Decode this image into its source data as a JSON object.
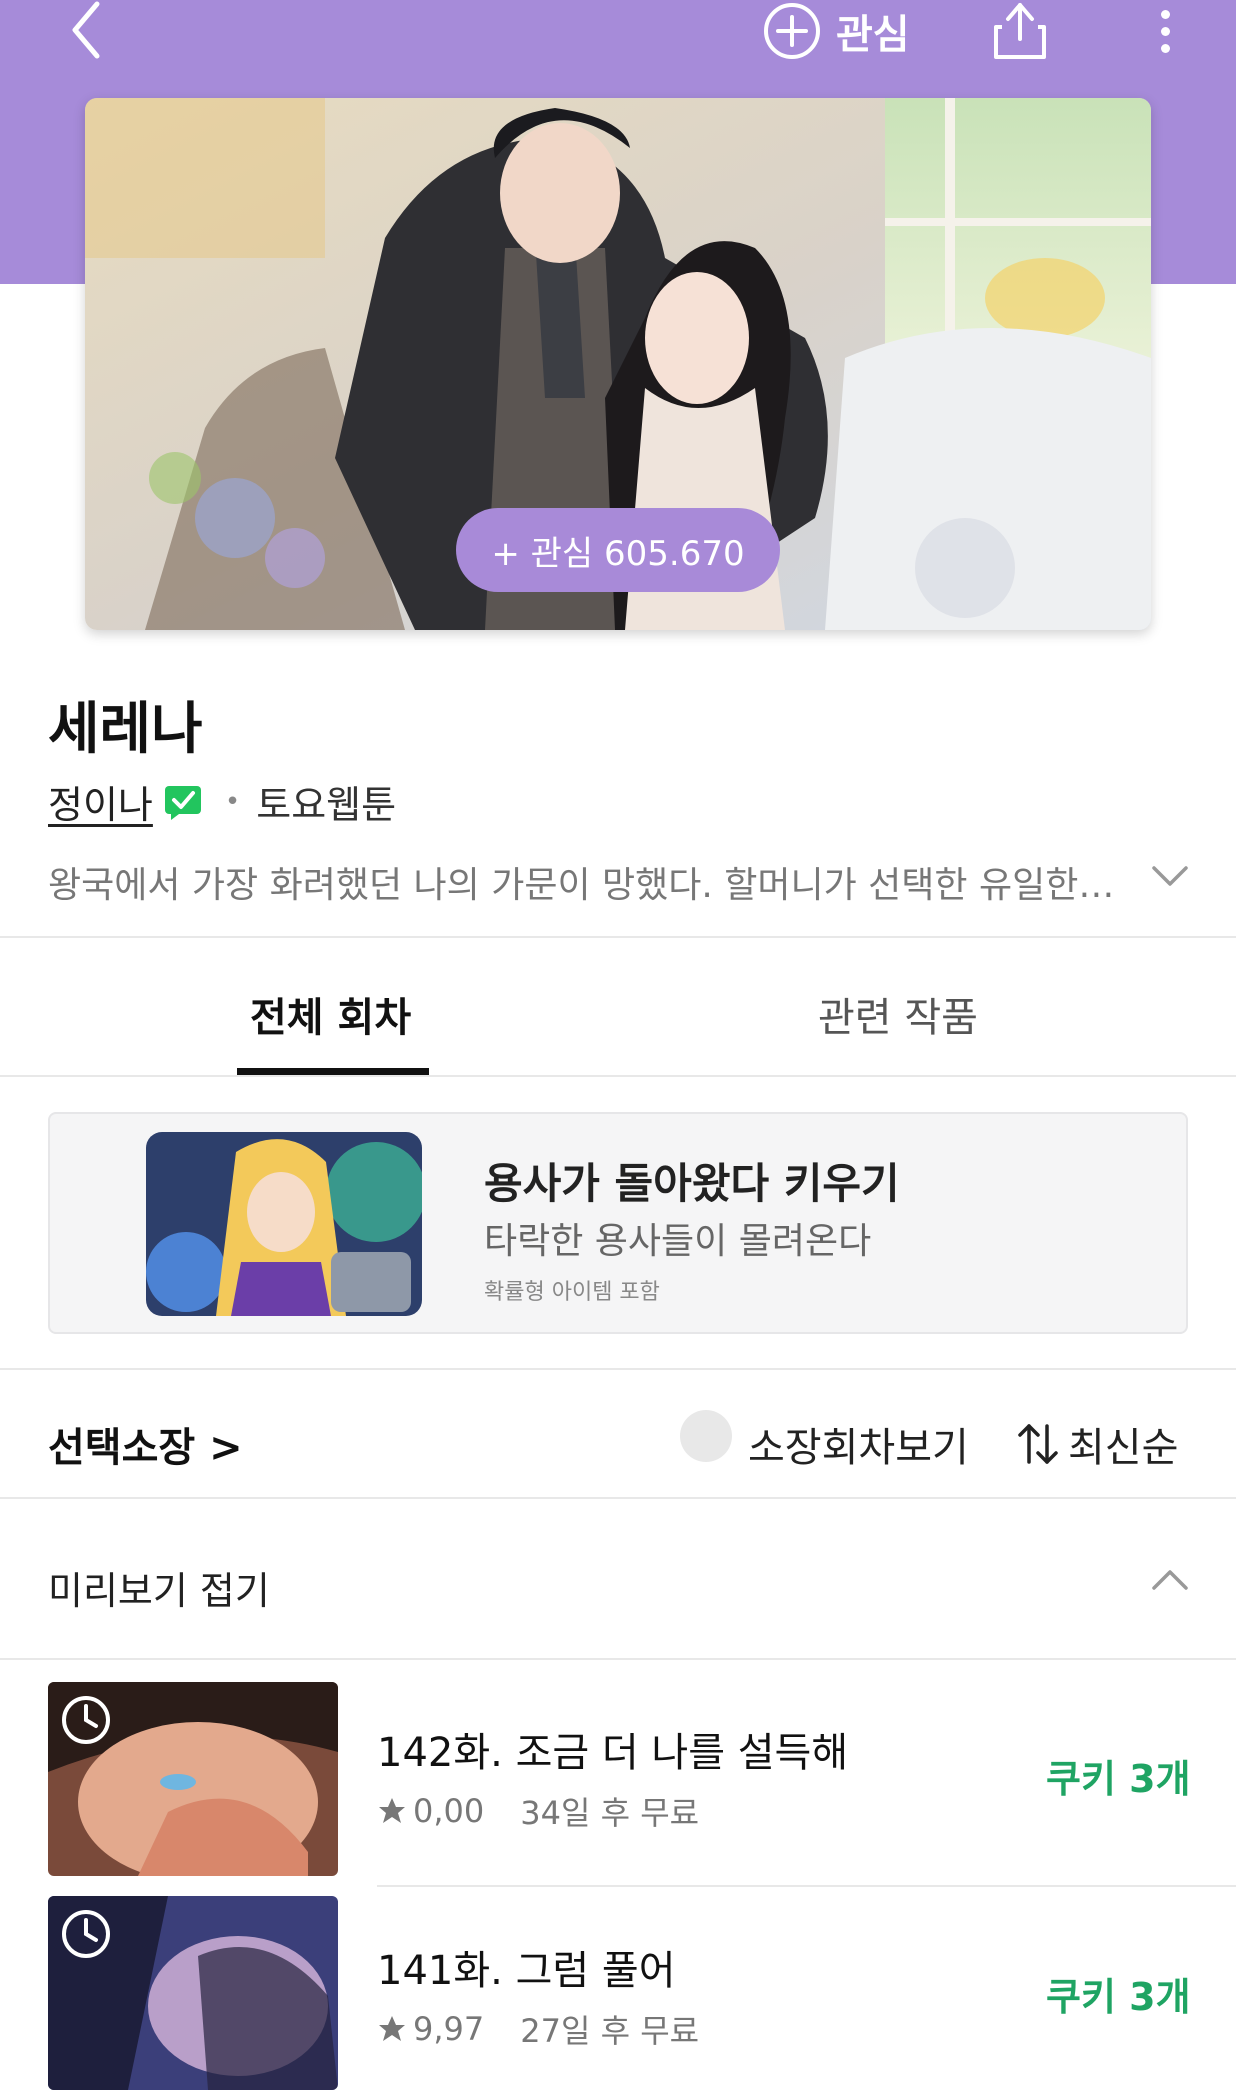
{
  "header": {
    "favorite_label": "관심",
    "icons": {
      "back": "chevron-left-icon",
      "favorite": "plus-circle-icon",
      "share": "share-icon",
      "more": "more-vertical-icon"
    }
  },
  "cover": {
    "favorite_badge": "+ 관심 605.670"
  },
  "series": {
    "title": "세레나",
    "author": "정이나",
    "day": "토요웹툰",
    "description": "왕국에서 가장 화려했던 나의 가문이 망했다. 할머니가 선택한 유일한 방..."
  },
  "tabs": [
    {
      "label": "전체 회차",
      "active": true
    },
    {
      "label": "관련 작품",
      "active": false
    }
  ],
  "ad": {
    "title": "용사가 돌아왔다 키우기",
    "subtitle": "타락한 용사들이 몰려온다",
    "note": "확률형 아이템 포함"
  },
  "controls": {
    "select_purchase": "선택소장 >",
    "owned_toggle_label": "소장회차보기",
    "sort_label": "최신순"
  },
  "preview": {
    "label": "미리보기 접기"
  },
  "episodes": [
    {
      "title": "142화. 조금 더 나를 설득해",
      "rating": "0,00",
      "free_in": "34일 후 무료",
      "price": "쿠키 3개"
    },
    {
      "title": "141화. 그럼 풀어",
      "rating": "9,97",
      "free_in": "27일 후 무료",
      "price": "쿠키 3개"
    }
  ],
  "colors": {
    "brand_purple": "#a68bd9",
    "cookie_green": "#1fa463",
    "verified_green": "#22c55e"
  }
}
